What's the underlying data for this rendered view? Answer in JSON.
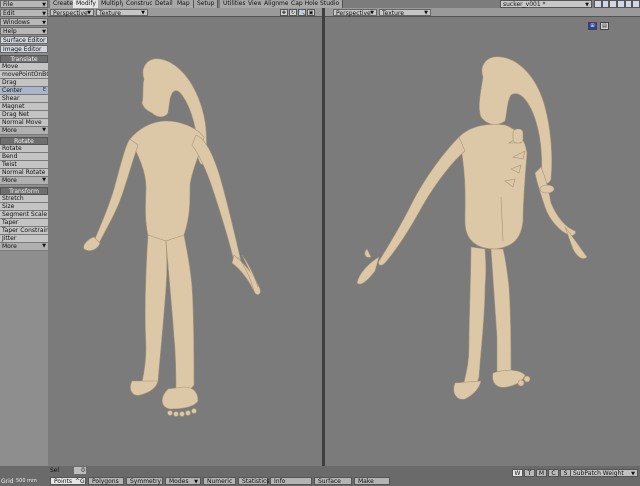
{
  "menus": [
    {
      "label": "File"
    },
    {
      "label": "Edit"
    },
    {
      "label": "Windows"
    },
    {
      "label": "Help"
    },
    {
      "label": "Surface Editor"
    },
    {
      "label": "Image Editor"
    }
  ],
  "tool_groups": [
    {
      "title": "Translate",
      "items": [
        "Move",
        "movePointOnBG",
        "Drag",
        "Center",
        "Shear",
        "Magnet",
        "Drag Net",
        "Normal Move"
      ],
      "more": "More",
      "active": "Center",
      "shortcut": "E"
    },
    {
      "title": "Rotate",
      "items": [
        "Rotate",
        "Bend",
        "Twist",
        "Normal Rotate"
      ],
      "more": "More"
    },
    {
      "title": "Transform",
      "items": [
        "Stretch",
        "Size",
        "Segment Scale",
        "Taper",
        "Taper Constrain",
        "Jitter"
      ],
      "more": "More"
    }
  ],
  "tabs": [
    "Create",
    "Modify",
    "Multiply",
    "Construct",
    "Detail",
    "Map",
    "Setup",
    "Utilities",
    "View",
    "Alignment",
    "Cap Hole Studio"
  ],
  "active_tab": "Modify",
  "scene_name": "sucker_v001 *",
  "viewports": [
    {
      "view": "Perspective",
      "shading": "Texture"
    },
    {
      "view": "Perspective",
      "shading": "Texture"
    }
  ],
  "bottom": {
    "sel_label": "Sel",
    "sel_count": "0",
    "grid_label": "Grid",
    "grid_value": "500 mm",
    "modes": [
      {
        "label": "Points",
        "shortcut": "^G",
        "active": true
      },
      {
        "label": "Polygons"
      },
      {
        "label": "Symmetry"
      },
      {
        "label": "Modes",
        "arrow": true
      },
      {
        "label": "Numeric"
      },
      {
        "label": "Statistics"
      },
      {
        "label": "Info"
      },
      {
        "label": "Surface"
      },
      {
        "label": "Make"
      }
    ],
    "wtmcs": [
      "W",
      "T",
      "M",
      "C",
      "S"
    ],
    "subpatch": "SubPatch Weight"
  },
  "colors": {
    "accent": "#2b3fa6",
    "model": "#dcc7a6",
    "viewport_bg": "#7b7b7b"
  }
}
